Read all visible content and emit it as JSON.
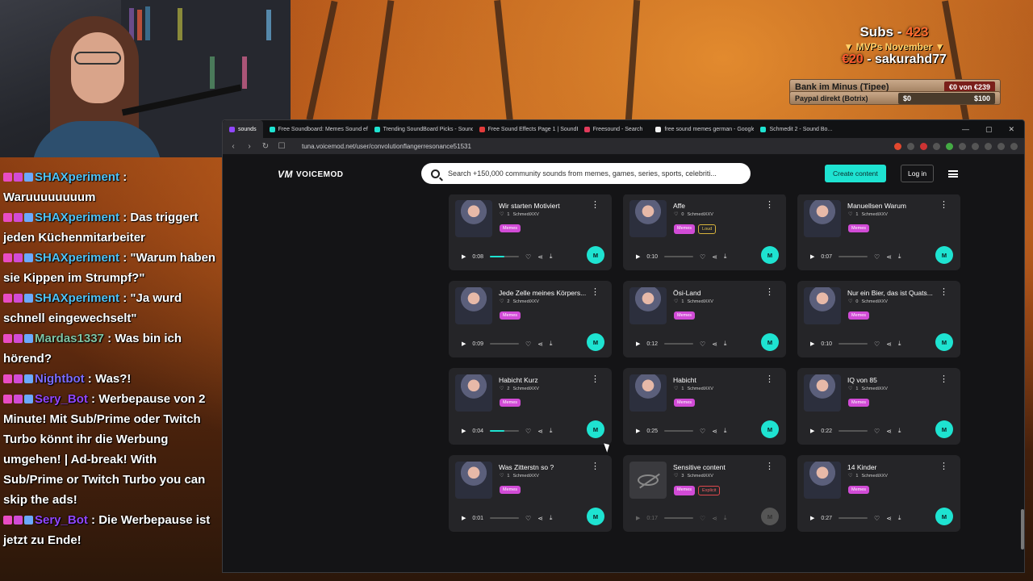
{
  "overlay": {
    "subs_label": "Subs - ",
    "subs_count": "423",
    "mvp_title": "▼ MVPs November ▼",
    "top_donor_amount": "€20",
    "top_donor_name": " - sakurahd77",
    "goal_label": "Bank im Minus (Tipee)",
    "goal_progress": "€0 von €239",
    "paypal_label": "Paypal direkt (Botrix)",
    "paypal_min": "$0",
    "paypal_max": "$100"
  },
  "chat": [
    {
      "user": "SHAXperiment",
      "text": " : Waruuuuuuuum",
      "color": "#4fc3f7"
    },
    {
      "user": "SHAXperiment",
      "text": " : Das triggert jeden Küchenmitarbeiter",
      "color": "#4fc3f7"
    },
    {
      "user": "SHAXperiment",
      "text": " : \"Warum haben sie Kippen im Strumpf?\"",
      "color": "#4fc3f7"
    },
    {
      "user": "SHAXperiment",
      "text": " : \"Ja wurd schnell eingewechselt\"",
      "color": "#4fc3f7"
    },
    {
      "user": "Mardas1337",
      "text": " : Was bin ich hörend?",
      "color": "#7fc4a3"
    },
    {
      "user": "Nightbot",
      "text": " : Was?!",
      "color": "#7b6cff"
    },
    {
      "user": "Sery_Bot",
      "text": " : Werbepause von 2 Minute! Mit Sub/Prime oder Twitch Turbo könnt ihr die Werbung umgehen! | Ad-break! With Sub/Prime or Twitch Turbo you can skip the ads!",
      "color": "#9146ff"
    },
    {
      "user": "Sery_Bot",
      "text": " : Die Werbepause ist jetzt zu Ende!",
      "color": "#9146ff"
    }
  ],
  "browser": {
    "tabs": [
      {
        "label": "sounds",
        "active": true,
        "color": "#9146ff"
      },
      {
        "label": "Free Soundboard: Memes Sound effe",
        "active": false,
        "color": "#1ee3d1"
      },
      {
        "label": "Trending SoundBoard Picks - SoundB",
        "active": false,
        "color": "#1ee3d1"
      },
      {
        "label": "Free Sound Effects Page 1 | SoundBi",
        "active": false,
        "color": "#e23b3b"
      },
      {
        "label": "Freesound - Search",
        "active": false,
        "color": "#e23b5b"
      },
      {
        "label": "free sound memes german - Google",
        "active": false,
        "color": "#f2f2f2"
      },
      {
        "label": "Schmedit 2 - Sound Bo...",
        "active": false,
        "color": "#1ee3d1"
      }
    ],
    "url": "tuna.voicemod.net/user/convolutionflangerresonance51531"
  },
  "site": {
    "logo": "VOICEMOD",
    "search_placeholder": "Search +150,000 community sounds from memes, games, series, sports, celebriti...",
    "create_label": "Create content",
    "login_label": "Log in"
  },
  "sounds": [
    {
      "title": "Wir starten Motiviert",
      "likes": "1",
      "author": "SchmediXXV",
      "tags": [
        "Memes"
      ],
      "duration": "0:08",
      "progress": 0.5
    },
    {
      "title": "Affe",
      "likes": "0",
      "author": "SchmediXXV",
      "tags": [
        "Memes",
        "Loud"
      ],
      "duration": "0:10",
      "progress": 0
    },
    {
      "title": "Manuellsen Warum",
      "likes": "1",
      "author": "SchmediXXV",
      "tags": [
        "Memes"
      ],
      "duration": "0:07",
      "progress": 0
    },
    {
      "title": "Jede Zelle meines Körpers...",
      "likes": "2",
      "author": "SchmediXXV",
      "tags": [
        "Memes"
      ],
      "duration": "0:09",
      "progress": 0
    },
    {
      "title": "Ösi-Land",
      "likes": "1",
      "author": "SchmediXXV",
      "tags": [
        "Memes"
      ],
      "duration": "0:12",
      "progress": 0
    },
    {
      "title": "Nur ein Bier, das ist Quats...",
      "likes": "0",
      "author": "SchmediXXV",
      "tags": [
        "Memes"
      ],
      "duration": "0:10",
      "progress": 0
    },
    {
      "title": "Habicht Kurz",
      "likes": "2",
      "author": "SchmediXXV",
      "tags": [
        "Memes"
      ],
      "duration": "0:04",
      "progress": 0.5
    },
    {
      "title": "Habicht",
      "likes": "1",
      "author": "SchmediXXV",
      "tags": [
        "Memes"
      ],
      "duration": "0:25",
      "progress": 0
    },
    {
      "title": "IQ von 85",
      "likes": "1",
      "author": "SchmediXXV",
      "tags": [
        "Memes"
      ],
      "duration": "0:22",
      "progress": 0
    },
    {
      "title": "Was Zitterstn so ?",
      "likes": "1",
      "author": "SchmediXXV",
      "tags": [
        "Memes"
      ],
      "duration": "0:01",
      "progress": 0
    },
    {
      "title": "Sensitive content",
      "likes": "3",
      "author": "SchmediXXV",
      "tags": [
        "Memes",
        "Explicit"
      ],
      "duration": "0:17",
      "progress": 0,
      "sensitive": true
    },
    {
      "title": "14 Kinder",
      "likes": "1",
      "author": "SchmediXXV",
      "tags": [
        "Memes"
      ],
      "duration": "0:27",
      "progress": 0
    }
  ]
}
